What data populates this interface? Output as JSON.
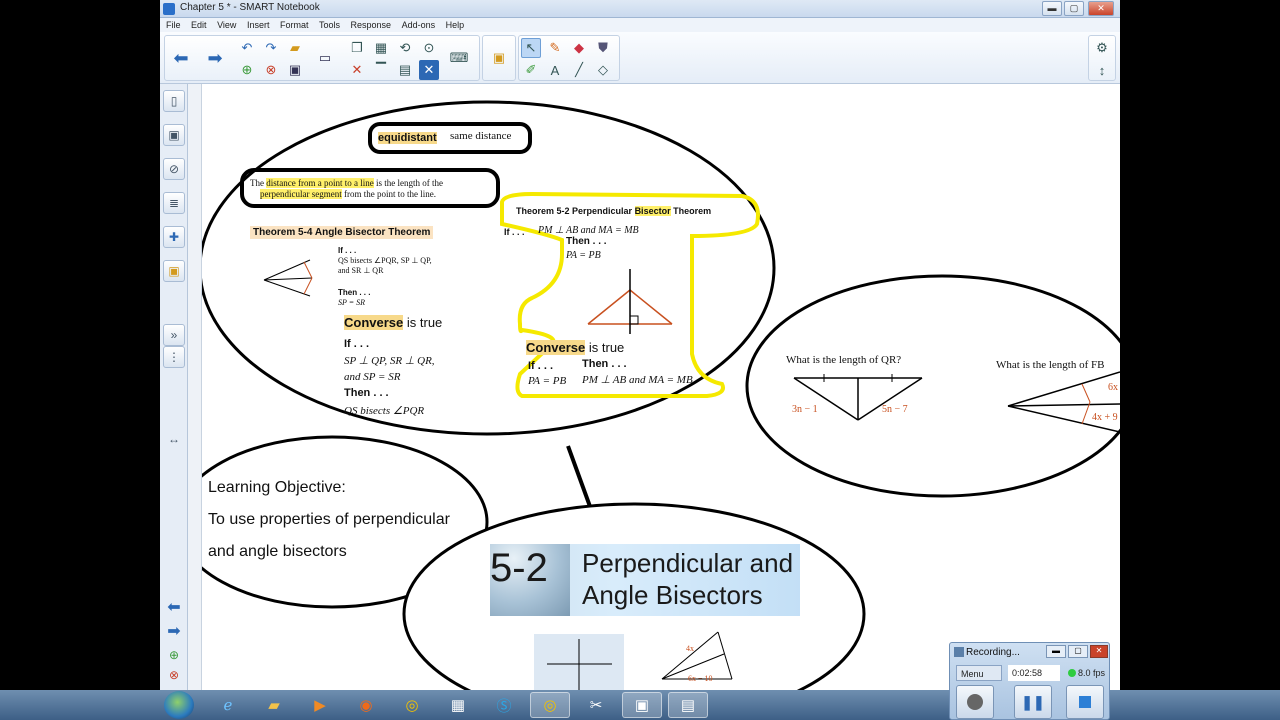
{
  "window": {
    "title": "Chapter 5 * - SMART Notebook",
    "min": "▬",
    "max": "▢",
    "close": "✕"
  },
  "menu": [
    "File",
    "Edit",
    "View",
    "Insert",
    "Format",
    "Tools",
    "Response",
    "Add-ons",
    "Help"
  ],
  "toolbar_icons": [
    "back-arrow-icon",
    "forward-arrow-icon",
    "undo-icon",
    "redo-icon",
    "open-icon",
    "add-page-icon",
    "delete-page-icon",
    "save-icon",
    "screen-shade-icon",
    "paste-icon",
    "screen-capture-icon",
    "reload-icon",
    "fill-icon",
    "select-icon",
    "pen-icon",
    "eraser-icon",
    "line-icon",
    "shape-icon",
    "text-icon",
    "settings-icon"
  ],
  "canvas": {
    "equidistant_word": "equidistant",
    "equidistant_colon": ":",
    "equidistant_def": "same distance",
    "distance_pre": "The",
    "distance_hl": "distance from a point to a line",
    "distance_mid": "is the length of the",
    "distance_hl2": "perpendicular segment",
    "distance_post": "from the point to the line.",
    "thm54_title": "Theorem 5-4   Angle Bisector Theorem",
    "thm54_if": "If . . .",
    "thm54_if_text": "QS bisects ∠PQR, SP ⊥ QP,",
    "thm54_if_text2": "and SR ⊥ QR",
    "thm54_then": "Then . . .",
    "thm54_then_text": "SP = SR",
    "converse_left": "Converse",
    "is_true_left": "is true",
    "conv_if": "If . . .",
    "conv_if_text": "SP ⊥ QP, SR ⊥ QR,",
    "conv_if_text2": "and SP = SR",
    "conv_then": "Then . . .",
    "conv_then_text": "QS bisects ∠PQR",
    "thm52_title_a": "Theorem 5-2   Perpendicular",
    "thm52_title_b": "Bisector",
    "thm52_title_c": "Theorem",
    "thm52_if": "If . . .",
    "thm52_if_text": "PM ⊥ AB and MA = MB",
    "thm52_then": "Then . . .",
    "thm52_then_text": "PA = PB",
    "converse_right": "Converse",
    "is_true_right": "is true",
    "r_if": "If . . .",
    "r_if_text": "PA = PB",
    "r_then": "Then . . .",
    "r_then_text": "PM ⊥ AB and MA = MB",
    "q1": "What is the length of QR?",
    "q1_left_expr": "3n − 1",
    "q1_right_expr": "5n − 7",
    "q2": "What is the length of FB",
    "q2_expr1": "6x",
    "q2_expr2": "4x + 9",
    "objective_title": "Learning Objective:",
    "objective_line1": "To use properties of perpendicular",
    "objective_line2": "and angle bisectors",
    "banner_num": "5-2",
    "banner_title1": "Perpendicular and",
    "banner_title2": "Angle Bisectors",
    "tri_expr1": "4x",
    "tri_expr2": "6x − 10"
  },
  "recording": {
    "title": "Recording...",
    "menu": "Menu",
    "time": "0:02:58",
    "fps": "8.0 fps"
  },
  "taskbar_icons": [
    "ie-icon",
    "explorer-icon",
    "media-player-icon",
    "firefox-icon",
    "chrome-icon",
    "apps-icon",
    "skype-icon",
    "chrome-alt-icon",
    "snipping-icon",
    "smart-notebook-icon",
    "recorder-icon"
  ],
  "colors": {
    "highlight_orange": "#f7d98a",
    "highlight_yellow": "#fff06a",
    "accent_red": "#c8501f",
    "outline_yellow": "#f5e900"
  }
}
